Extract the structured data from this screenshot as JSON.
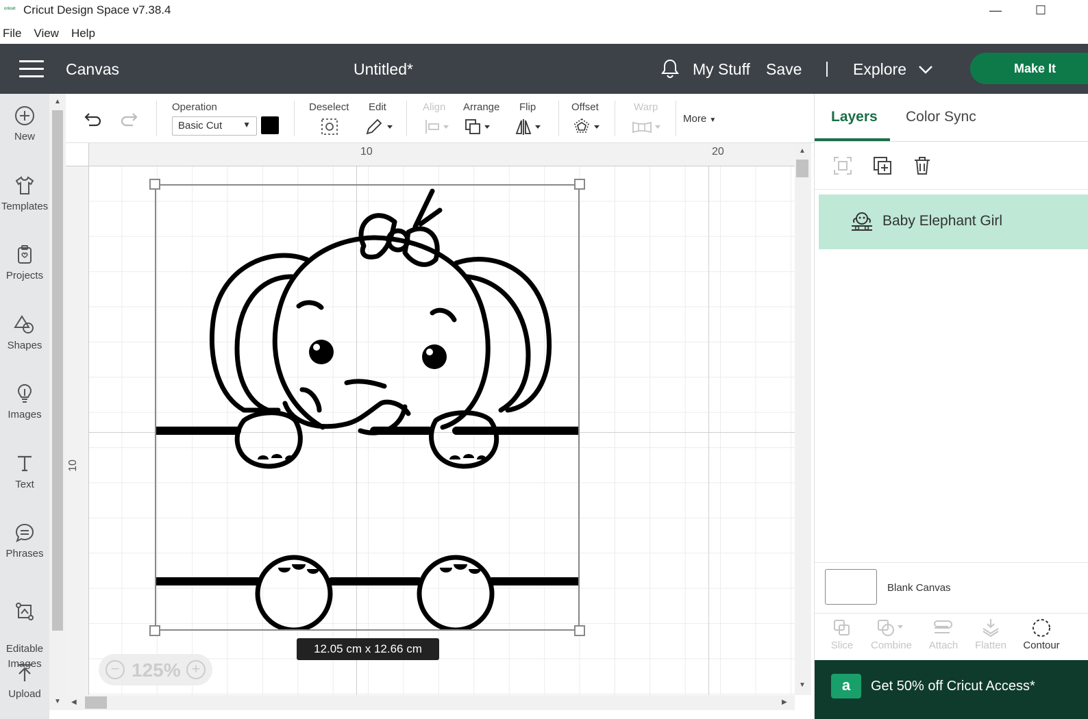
{
  "window": {
    "logo_text": "cricut",
    "title": "Cricut Design Space  v7.38.4",
    "minimize": "—",
    "maximize": "☐"
  },
  "menu": [
    "File",
    "View",
    "Help"
  ],
  "header": {
    "section": "Canvas",
    "doc_title": "Untitled*",
    "my_stuff": "My Stuff",
    "save": "Save",
    "separator": "|",
    "explore": "Explore",
    "make_it": "Make It",
    "accent_color": "#0e7a4a"
  },
  "sidebar": [
    {
      "label": "New",
      "icon": "plus-circle-icon"
    },
    {
      "label": "Templates",
      "icon": "tshirt-icon"
    },
    {
      "label": "Projects",
      "icon": "clipboard-icon"
    },
    {
      "label": "Shapes",
      "icon": "shapes-icon"
    },
    {
      "label": "Images",
      "icon": "lightbulb-icon"
    },
    {
      "label": "Text",
      "icon": "text-icon"
    },
    {
      "label": "Phrases",
      "icon": "speech-bubble-icon"
    },
    {
      "label": "Editable\nImages",
      "icon": "editable-image-icon"
    },
    {
      "label": "Upload",
      "icon": "upload-icon"
    }
  ],
  "toolbar": {
    "operation_label": "Operation",
    "operation_value": "Basic Cut",
    "operation_color": "#000000",
    "deselect": "Deselect",
    "edit": "Edit",
    "align": "Align",
    "arrange": "Arrange",
    "flip": "Flip",
    "offset": "Offset",
    "warp": "Warp",
    "more": "More"
  },
  "canvas": {
    "ruler_top": [
      "10",
      "20"
    ],
    "ruler_left": [
      "10"
    ],
    "dimensions": "12.05  cm x 12.66  cm",
    "zoom": "125%"
  },
  "panel": {
    "tabs": [
      "Layers",
      "Color Sync"
    ],
    "layers": [
      {
        "name": "Baby Elephant Girl",
        "icon": "elephant-group-icon"
      }
    ],
    "blank_canvas": "Blank Canvas",
    "actions": [
      {
        "label": "Slice",
        "enabled": false
      },
      {
        "label": "Combine",
        "enabled": false
      },
      {
        "label": "Attach",
        "enabled": false
      },
      {
        "label": "Flatten",
        "enabled": false
      },
      {
        "label": "Contour",
        "enabled": true
      }
    ],
    "promo_badge": "a",
    "promo": "Get 50% off Cricut Access*"
  }
}
